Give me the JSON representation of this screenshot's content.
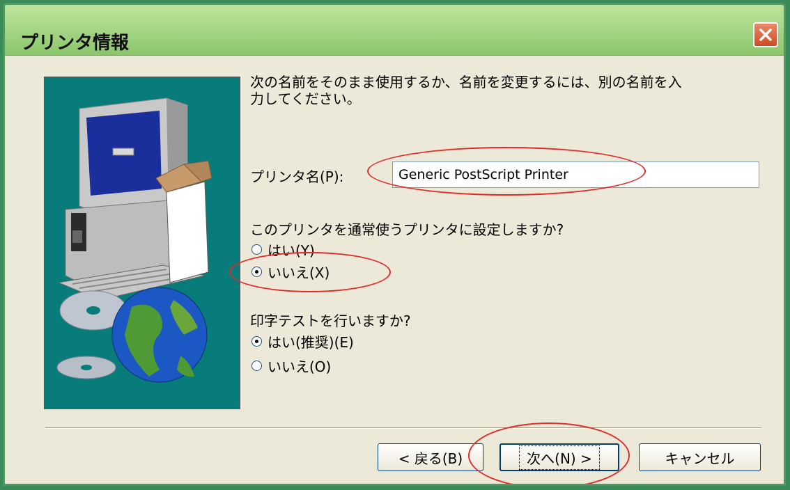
{
  "window": {
    "title": "プリンタ情報"
  },
  "prompt": {
    "line1": "次の名前をそのまま使用するか、名前を変更するには、別の名前を入",
    "line2": "力してください。"
  },
  "printer_name": {
    "label": "プリンタ名(P):",
    "value": "Generic PostScript Printer"
  },
  "default_printer": {
    "question": "このプリンタを通常使うプリンタに設定しますか?",
    "options": [
      {
        "label": "はい(Y)",
        "checked": false
      },
      {
        "label": "いいえ(X)",
        "checked": true
      }
    ]
  },
  "test_page": {
    "question": "印字テストを行いますか?",
    "options": [
      {
        "label": "はい(推奨)(E)",
        "checked": true
      },
      {
        "label": "いいえ(O)",
        "checked": false
      }
    ]
  },
  "buttons": {
    "back": "< 戻る(B)",
    "next": "次へ(N) >",
    "cancel": "キャンセル"
  },
  "colors": {
    "title_bar": "#a9d98a",
    "illustration_bg": "#087b7b",
    "annotation": "#e12b2b"
  }
}
